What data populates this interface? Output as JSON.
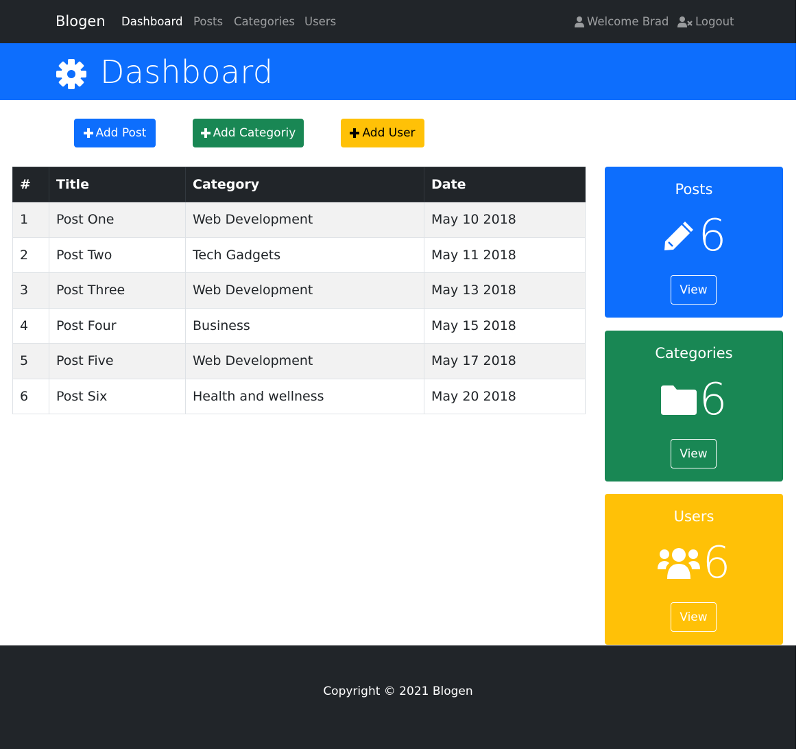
{
  "navbar": {
    "brand": "Blogen",
    "links": [
      "Dashboard",
      "Posts",
      "Categories",
      "Users"
    ],
    "welcome": "Welcome Brad",
    "logout": "Logout"
  },
  "header": {
    "title": "Dashboard",
    "icon": "gear-icon"
  },
  "actions": {
    "add_post": "Add Post",
    "add_category": "Add Categoriy",
    "add_user": "Add User"
  },
  "table": {
    "headers": [
      "#",
      "Title",
      "Category",
      "Date"
    ],
    "rows": [
      [
        "1",
        "Post One",
        "Web Development",
        "May 10 2018"
      ],
      [
        "2",
        "Post Two",
        "Tech Gadgets",
        "May 11 2018"
      ],
      [
        "3",
        "Post Three",
        "Web Development",
        "May 13 2018"
      ],
      [
        "4",
        "Post Four",
        "Business",
        "May 15 2018"
      ],
      [
        "5",
        "Post Five",
        "Web Development",
        "May 17 2018"
      ],
      [
        "6",
        "Post Six",
        "Health and wellness",
        "May 20 2018"
      ]
    ]
  },
  "cards": {
    "posts": {
      "title": "Posts",
      "count": "6",
      "view": "View",
      "icon": "pencil-icon"
    },
    "categories": {
      "title": "Categories",
      "count": "6",
      "view": "View",
      "icon": "folder-icon"
    },
    "users": {
      "title": "Users",
      "count": "6",
      "view": "View",
      "icon": "users-icon"
    }
  },
  "footer": {
    "copyright": "Copyright © 2021 Blogen"
  },
  "colors": {
    "primary": "#0d6efd",
    "success": "#198754",
    "warning": "#ffc107",
    "dark": "#212529"
  }
}
